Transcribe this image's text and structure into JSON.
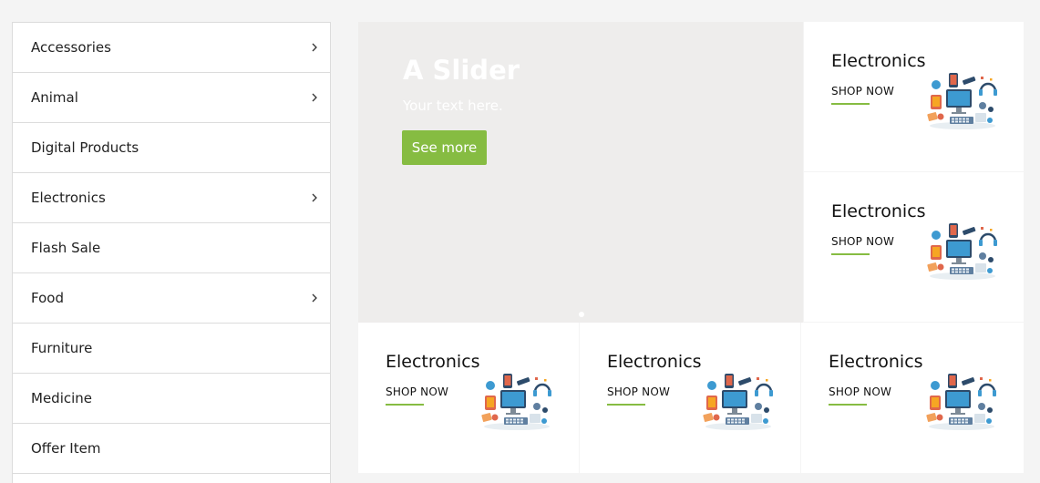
{
  "sidebar": {
    "items": [
      {
        "label": "Accessories",
        "has_children": true
      },
      {
        "label": "Animal",
        "has_children": true
      },
      {
        "label": "Digital Products",
        "has_children": false
      },
      {
        "label": "Electronics",
        "has_children": true
      },
      {
        "label": "Flash Sale",
        "has_children": false
      },
      {
        "label": "Food",
        "has_children": true
      },
      {
        "label": "Furniture",
        "has_children": false
      },
      {
        "label": "Medicine",
        "has_children": false
      },
      {
        "label": "Offer Item",
        "has_children": false
      }
    ]
  },
  "slider": {
    "title": "A Slider",
    "subtitle": "Your text here.",
    "button_label": "See more",
    "accent_color": "#86bc42"
  },
  "promos": [
    {
      "title": "Electronics",
      "link_label": "SHOP NOW",
      "icon": "electronics-illustration-icon"
    },
    {
      "title": "Electronics",
      "link_label": "SHOP NOW",
      "icon": "electronics-illustration-icon"
    },
    {
      "title": "Electronics",
      "link_label": "SHOP NOW",
      "icon": "electronics-illustration-icon"
    },
    {
      "title": "Electronics",
      "link_label": "SHOP NOW",
      "icon": "electronics-illustration-icon"
    },
    {
      "title": "Electronics",
      "link_label": "SHOP NOW",
      "icon": "electronics-illustration-icon"
    }
  ]
}
